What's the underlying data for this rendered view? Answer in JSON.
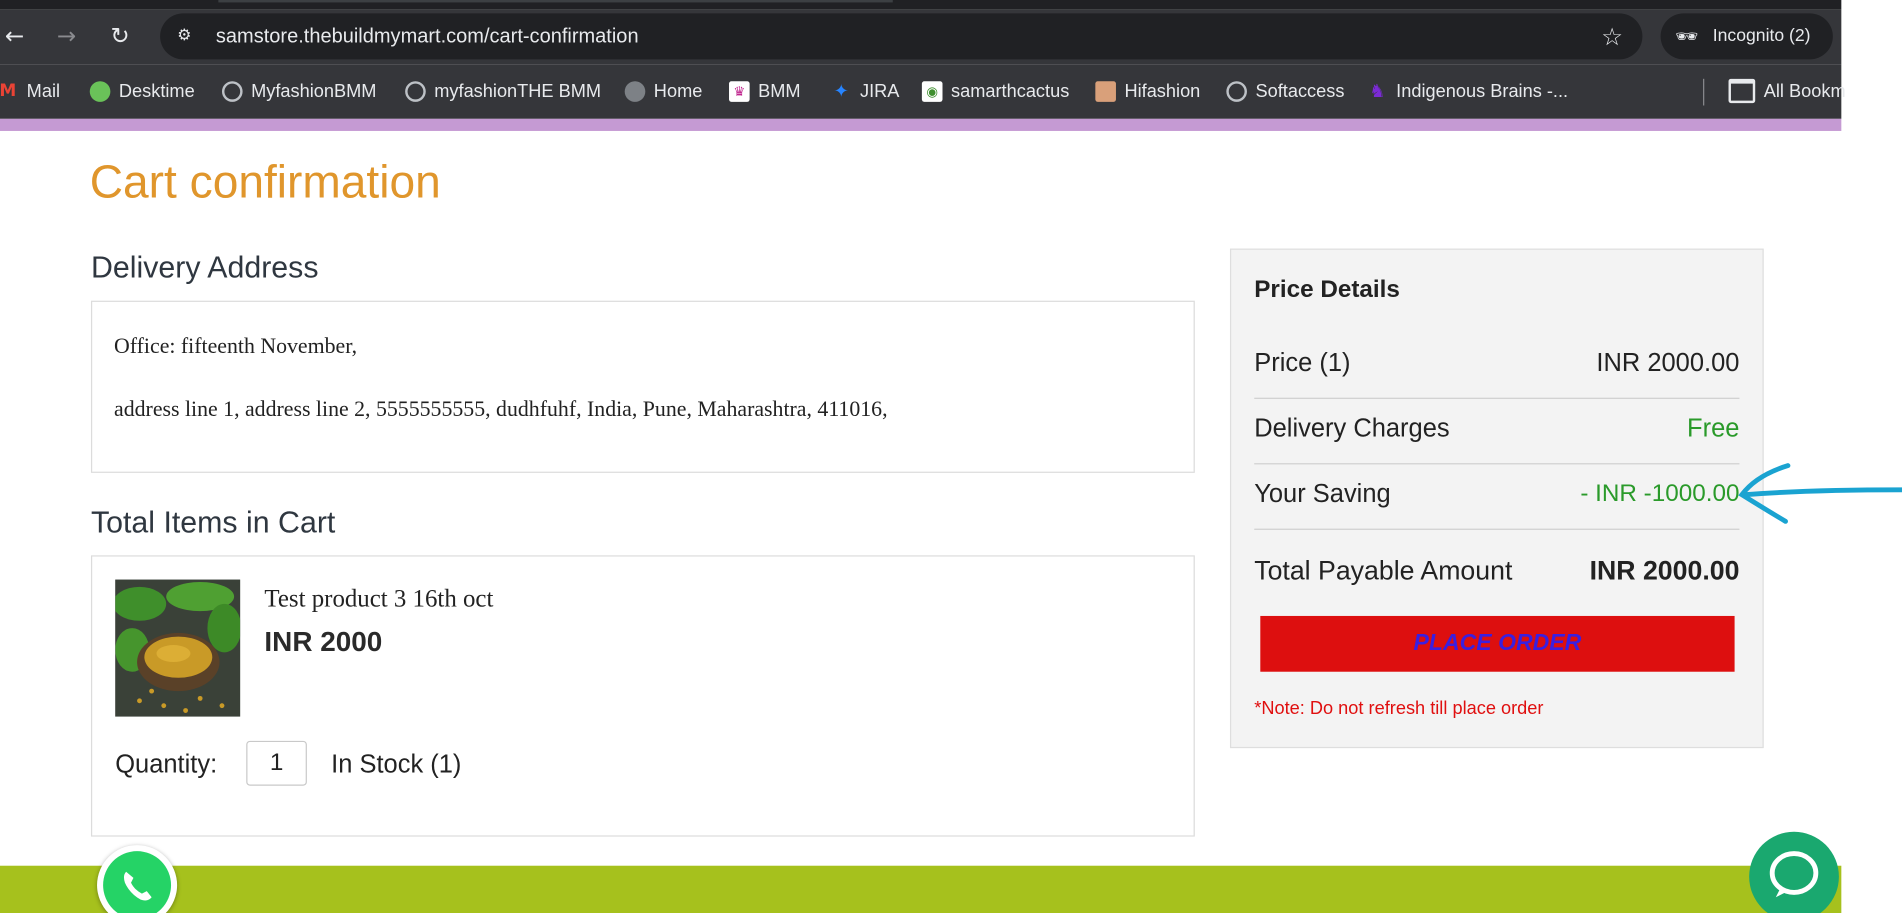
{
  "browser": {
    "url": "samstore.thebuildmymart.com/cart-confirmation",
    "profile_label": "Incognito (2)",
    "bookmarks": [
      {
        "label": "Mail",
        "icon": "gmail-icon",
        "color": "#ea4335"
      },
      {
        "label": "Desktime",
        "icon": "desktime-icon",
        "color": "#6ac259"
      },
      {
        "label": "MyfashionBMM",
        "icon": "globe-icon",
        "color": "#bdc1c6"
      },
      {
        "label": "myfashionTHE BMM",
        "icon": "globe-icon",
        "color": "#bdc1c6"
      },
      {
        "label": "Home",
        "icon": "globe-icon",
        "color": "#7d8186"
      },
      {
        "label": "BMM",
        "icon": "bmm-icon",
        "color": "#c0268f"
      },
      {
        "label": "JIRA",
        "icon": "jira-icon",
        "color": "#2684ff"
      },
      {
        "label": "samarthcactus",
        "icon": "cactus-icon",
        "color": "#3f8f2f"
      },
      {
        "label": "Hifashion",
        "icon": "hifashion-icon",
        "color": "#d9a07a"
      },
      {
        "label": "Softaccess",
        "icon": "globe-icon",
        "color": "#bdc1c6"
      },
      {
        "label": "Indigenous Brains -...",
        "icon": "indigenous-brains-icon",
        "color": "#7b2ad6"
      }
    ],
    "all_bookmarks_label": "All Bookm"
  },
  "page": {
    "title": "Cart confirmation",
    "delivery": {
      "heading": "Delivery Address",
      "line1": "Office: fifteenth November,",
      "line2": "address line 1, address line 2, 5555555555, dudhfuhf, India, Pune, Maharashtra, 411016,"
    },
    "cart": {
      "heading": "Total Items in Cart",
      "item": {
        "name": "Test product 3 16th oct",
        "price": "INR 2000",
        "quantity_label": "Quantity:",
        "quantity": "1",
        "stock": "In Stock (1)"
      }
    },
    "price_details": {
      "title": "Price Details",
      "price_label": "Price  (1)",
      "price_value": "INR  2000.00",
      "delivery_label": "Delivery Charges",
      "delivery_value": "Free",
      "saving_label": "Your Saving",
      "saving_value": "- INR  -1000.00",
      "total_label": "Total Payable Amount",
      "total_value": "INR  2000.00",
      "place_order": "PLACE ORDER",
      "note": "*Note: Do not refresh till place order"
    }
  },
  "colors": {
    "title": "#e0962c",
    "green": "#2a9a2a",
    "button_bg": "#dd0f0f",
    "button_text": "#3a1fe0",
    "footer": "#a6c11d",
    "annotation_arrow": "#1aa3d1"
  }
}
